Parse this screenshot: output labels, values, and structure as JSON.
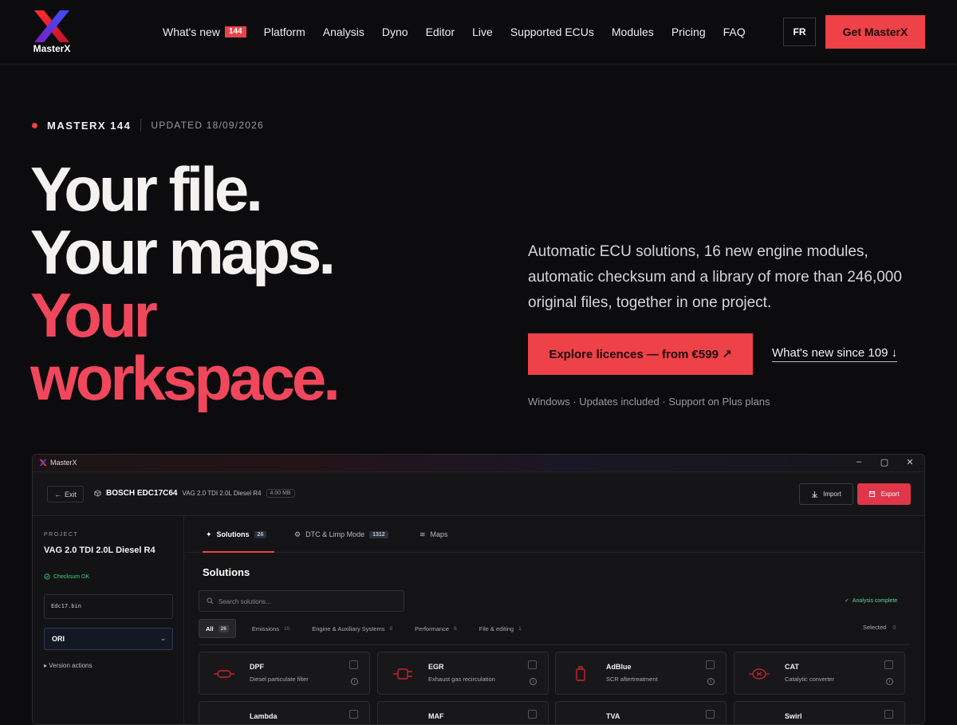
{
  "brand": {
    "name": "MasterX",
    "accent": "#ee4148",
    "headline_accent": "#f0475c",
    "background": "#0c0c0e"
  },
  "nav": {
    "items": [
      {
        "label": "What's new",
        "badge": "144"
      },
      {
        "label": "Platform"
      },
      {
        "label": "Analysis"
      },
      {
        "label": "Dyno"
      },
      {
        "label": "Editor"
      },
      {
        "label": "Live"
      },
      {
        "label": "Supported ECUs"
      },
      {
        "label": "Modules"
      },
      {
        "label": "Pricing"
      },
      {
        "label": "FAQ"
      }
    ],
    "lang": "FR",
    "cta": "Get MasterX"
  },
  "hero": {
    "eyebrow_title": "MASTERX 144",
    "eyebrow_date": "UPDATED 18/09/2026",
    "headline": [
      "Your file.",
      "Your maps.",
      "Your",
      "workspace."
    ],
    "lead": "Automatic ECU solutions, 16 new engine modules, automatic checksum and a library of more than 246,000 original files, together in one project.",
    "primary_cta": "Explore licences — from €599 ↗",
    "secondary_cta": "What's new since 109 ↓",
    "meta": "Windows · Updates included · Support on Plus plans"
  },
  "app": {
    "window_title": "MasterX",
    "exit_label": "Exit",
    "ecu_name": "BOSCH EDC17C64",
    "ecu_desc": "VAG 2.0 TDI 2.0L Diesel R4",
    "ecu_size": "4.00 MB",
    "import_label": "Import",
    "export_label": "Export",
    "sidebar": {
      "label": "PROJECT",
      "project": "VAG 2.0 TDI 2.0L Diesel R4",
      "checksum": "Checksum OK",
      "file": "Edc17.bin",
      "version": "ORI",
      "version_actions": "Version actions"
    },
    "tabs": [
      {
        "label": "Solutions",
        "count": "26",
        "icon": "sparkle-icon"
      },
      {
        "label": "DTC & Limp Mode",
        "count": "1312",
        "icon": "gear-icon"
      },
      {
        "label": "Maps",
        "count": "",
        "icon": "layers-icon"
      }
    ],
    "section_title": "Solutions",
    "search_placeholder": "Search solutions...",
    "analysis_status": "Analysis complete",
    "filters": [
      {
        "label": "All",
        "count": "26"
      },
      {
        "label": "Emissions",
        "count": "10"
      },
      {
        "label": "Engine & Auxiliary Systems",
        "count": "8"
      },
      {
        "label": "Performance",
        "count": "6"
      },
      {
        "label": "File & editing",
        "count": "1"
      }
    ],
    "selected_label": "Selected",
    "selected_count": "0",
    "cards": [
      {
        "title": "DPF",
        "desc": "Diesel particulate filter"
      },
      {
        "title": "EGR",
        "desc": "Exhaust gas recirculation"
      },
      {
        "title": "AdBlue",
        "desc": "SCR aftertreatment"
      },
      {
        "title": "CAT",
        "desc": "Catalytic converter"
      },
      {
        "title": "Lambda",
        "desc": ""
      },
      {
        "title": "MAF",
        "desc": ""
      },
      {
        "title": "TVA",
        "desc": ""
      },
      {
        "title": "Swirl",
        "desc": ""
      }
    ]
  }
}
